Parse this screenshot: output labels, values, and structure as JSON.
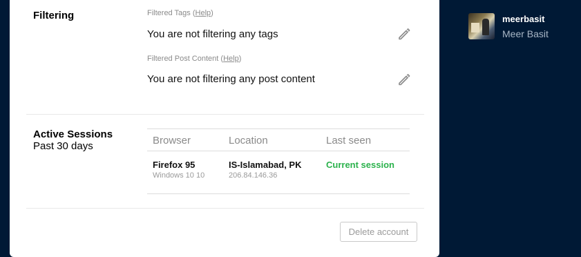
{
  "filtering": {
    "title": "Filtering",
    "tags": {
      "label": "Filtered Tags",
      "help": "Help",
      "value": "You are not filtering any tags"
    },
    "content": {
      "label": "Filtered Post Content",
      "help": "Help",
      "value": "You are not filtering any post content"
    }
  },
  "sessions": {
    "title": "Active Sessions",
    "subtitle": "Past 30 days",
    "columns": [
      "Browser",
      "Location",
      "Last seen"
    ],
    "rows": [
      {
        "browser": "Firefox 95",
        "os": "Windows 10 10",
        "location": "IS-Islamabad, PK",
        "ip": "206.84.146.36",
        "last_seen": "Current session"
      }
    ]
  },
  "delete_account_label": "Delete account",
  "profile": {
    "blog_name": "meerbasit",
    "blog_title": "Meer Basit"
  },
  "colors": {
    "background": "#001935",
    "current_session": "#2bb24c"
  },
  "icons": {
    "edit": "pencil-icon"
  }
}
